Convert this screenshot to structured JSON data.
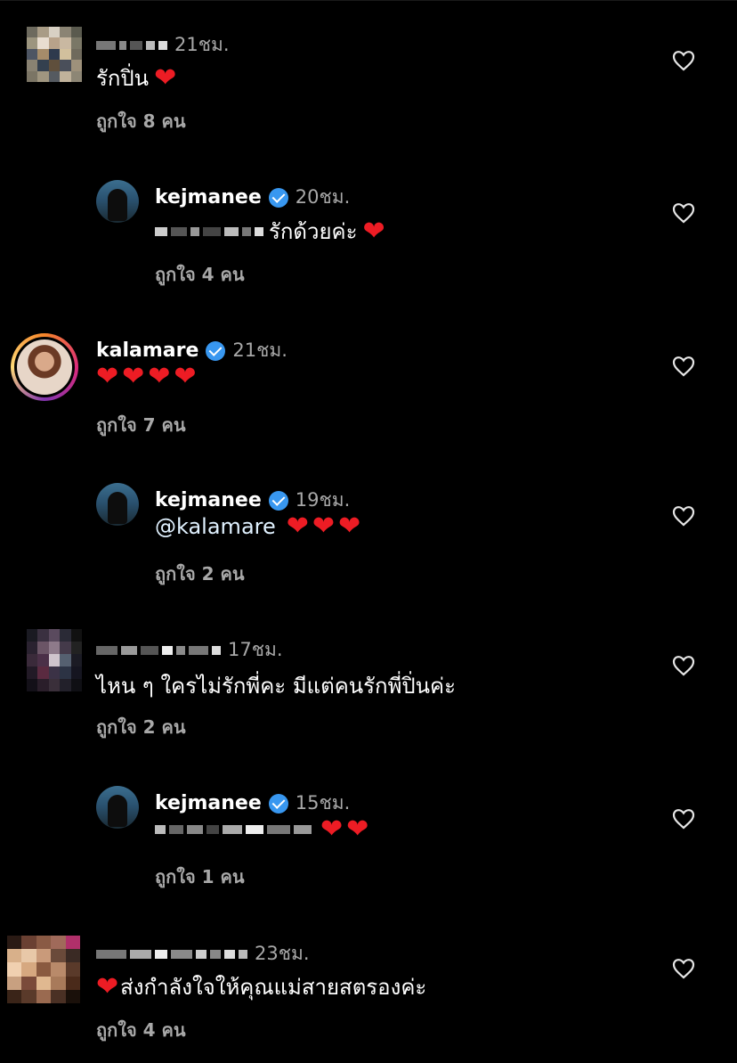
{
  "comments": [
    {
      "time": "21ชม.",
      "text": "รักปิ่น",
      "likes": "ถูกใจ 8 คน"
    },
    {
      "username": "kejmanee",
      "time": "20ชม.",
      "text": "รักด้วยค่ะ",
      "likes": "ถูกใจ 4 คน"
    },
    {
      "username": "kalamare",
      "time": "21ชม.",
      "likes": "ถูกใจ 7 คน"
    },
    {
      "username": "kejmanee",
      "time": "19ชม.",
      "mention": "@kalamare",
      "likes": "ถูกใจ 2 คน"
    },
    {
      "time": "17ชม.",
      "text": "ไหน ๆ ใครไม่รักพี่คะ มีแต่คนรักพี่ปิ่นค่ะ",
      "likes": "ถูกใจ 2 คน"
    },
    {
      "username": "kejmanee",
      "time": "15ชม.",
      "likes": "ถูกใจ 1 คน"
    },
    {
      "time": "23ชม.",
      "text": "ส่งกำลังใจให้คุณแม่สายสตรองค่ะ",
      "likes": "ถูกใจ 4 คน"
    }
  ],
  "icons": {
    "heart_emoji": "❤",
    "like_icon": "heart-outline-icon",
    "verified_icon": "verified-badge-icon"
  },
  "colors": {
    "background": "#000000",
    "heart": "#ed1c24",
    "verified": "#3897f0",
    "secondary_text": "#a8a8a8"
  }
}
